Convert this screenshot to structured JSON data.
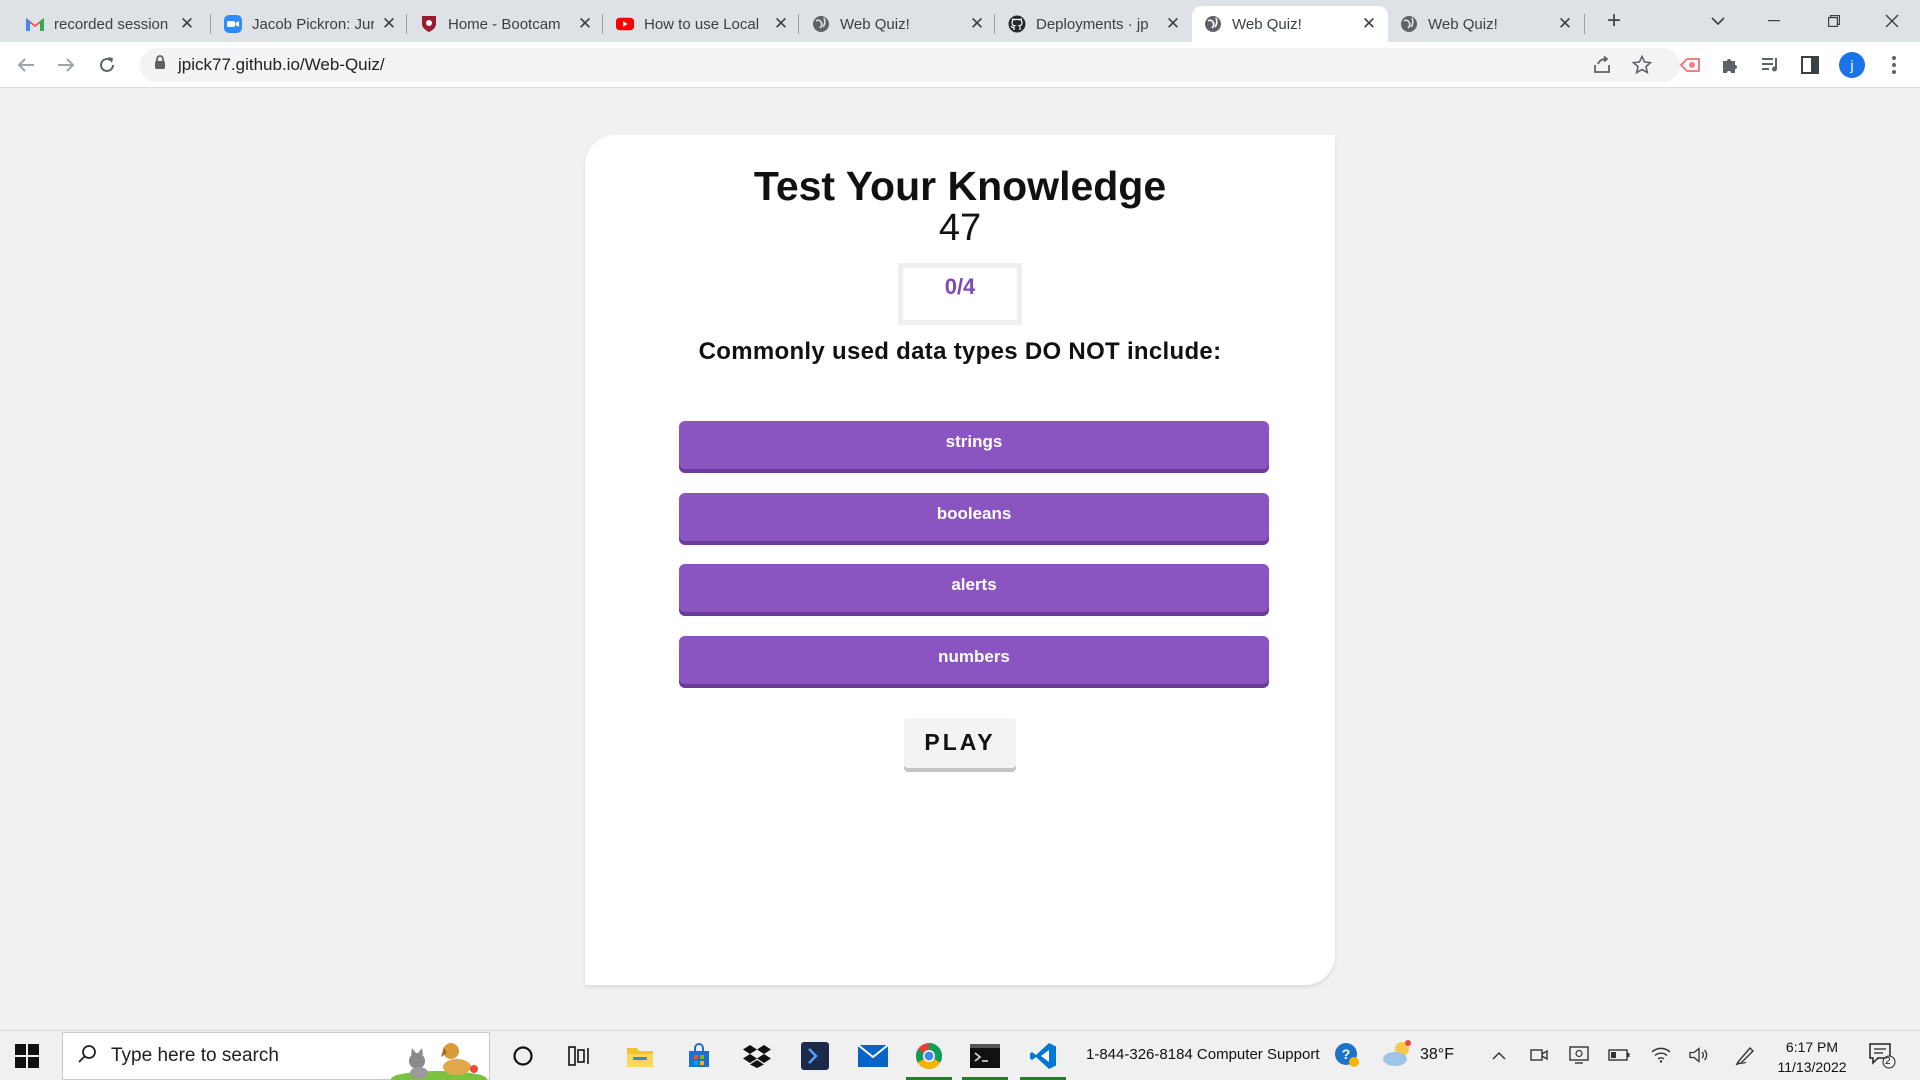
{
  "browser": {
    "tabs": [
      {
        "title": "recorded session",
        "icon": "gmail-icon"
      },
      {
        "title": "Jacob Pickron: Jur",
        "icon": "zoom-icon"
      },
      {
        "title": "Home - Bootcam",
        "icon": "bootcamp-shield-icon"
      },
      {
        "title": "How to use Local",
        "icon": "youtube-icon"
      },
      {
        "title": "Web Quiz!",
        "icon": "globe-icon"
      },
      {
        "title": "Deployments · jp",
        "icon": "github-icon"
      },
      {
        "title": "Web Quiz!",
        "icon": "globe-icon",
        "active": true
      },
      {
        "title": "Web Quiz!",
        "icon": "globe-icon"
      }
    ],
    "url": "jpick77.github.io/Web-Quiz/",
    "profile_initial": "j"
  },
  "quiz": {
    "title": "Test Your Knowledge",
    "timer": "47",
    "score": "0/4",
    "question": "Commonly used data types DO NOT include:",
    "answers": [
      "strings",
      "booleans",
      "alerts",
      "numbers"
    ],
    "play_label": "PLAY"
  },
  "taskbar": {
    "search_placeholder": "Type here to search",
    "support_text": "1-844-326-8184 Computer Support",
    "weather": "38°F",
    "time": "6:17 PM",
    "date": "11/13/2022",
    "notification_count": "2"
  },
  "colors": {
    "accent": "#8a55c0",
    "score": "#7e4ab8",
    "page_bg": "#f1f1f1"
  }
}
